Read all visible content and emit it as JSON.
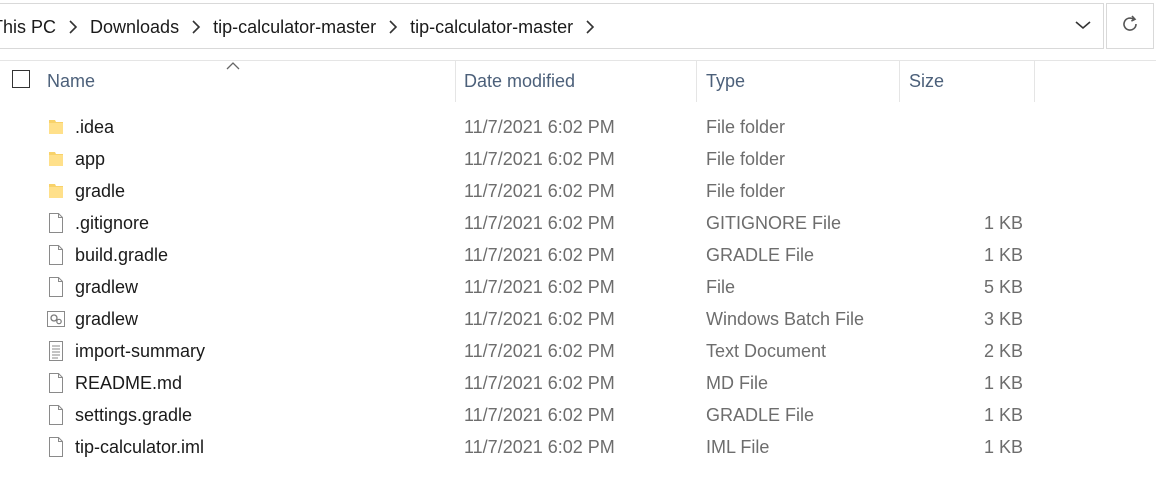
{
  "breadcrumb": {
    "items": [
      "This PC",
      "Downloads",
      "tip-calculator-master",
      "tip-calculator-master"
    ]
  },
  "columns": {
    "name": "Name",
    "date": "Date modified",
    "type": "Type",
    "size": "Size"
  },
  "files": [
    {
      "name": ".idea",
      "date": "11/7/2021 6:02 PM",
      "type": "File folder",
      "size": "",
      "icon": "folder-icon"
    },
    {
      "name": "app",
      "date": "11/7/2021 6:02 PM",
      "type": "File folder",
      "size": "",
      "icon": "folder-icon"
    },
    {
      "name": "gradle",
      "date": "11/7/2021 6:02 PM",
      "type": "File folder",
      "size": "",
      "icon": "folder-icon"
    },
    {
      "name": ".gitignore",
      "date": "11/7/2021 6:02 PM",
      "type": "GITIGNORE File",
      "size": "1 KB",
      "icon": "file-icon"
    },
    {
      "name": "build.gradle",
      "date": "11/7/2021 6:02 PM",
      "type": "GRADLE File",
      "size": "1 KB",
      "icon": "file-icon"
    },
    {
      "name": "gradlew",
      "date": "11/7/2021 6:02 PM",
      "type": "File",
      "size": "5 KB",
      "icon": "file-icon"
    },
    {
      "name": "gradlew",
      "date": "11/7/2021 6:02 PM",
      "type": "Windows Batch File",
      "size": "3 KB",
      "icon": "batch-file-icon"
    },
    {
      "name": "import-summary",
      "date": "11/7/2021 6:02 PM",
      "type": "Text Document",
      "size": "2 KB",
      "icon": "text-document-icon"
    },
    {
      "name": "README.md",
      "date": "11/7/2021 6:02 PM",
      "type": "MD File",
      "size": "1 KB",
      "icon": "file-icon"
    },
    {
      "name": "settings.gradle",
      "date": "11/7/2021 6:02 PM",
      "type": "GRADLE File",
      "size": "1 KB",
      "icon": "file-icon"
    },
    {
      "name": "tip-calculator.iml",
      "date": "11/7/2021 6:02 PM",
      "type": "IML File",
      "size": "1 KB",
      "icon": "file-icon"
    }
  ]
}
